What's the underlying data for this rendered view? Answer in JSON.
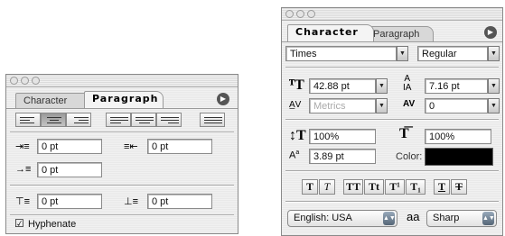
{
  "paragraph_panel": {
    "tabs": [
      {
        "label": "Character"
      },
      {
        "label": "Paragraph"
      }
    ],
    "menu_icon": "flyout-arrow-icon",
    "align_buttons": [
      "align-left",
      "align-center",
      "align-right",
      "justify-left",
      "justify-center",
      "justify-right",
      "justify-all"
    ],
    "left_indent": {
      "icon": "left-indent-icon",
      "value": "0 pt"
    },
    "right_indent": {
      "icon": "right-indent-icon",
      "value": "0 pt"
    },
    "first_line_indent": {
      "icon": "first-line-indent-icon",
      "value": "0 pt"
    },
    "space_before": {
      "icon": "space-before-icon",
      "value": "0 pt"
    },
    "space_after": {
      "icon": "space-after-icon",
      "value": "0 pt"
    },
    "hyphenate": {
      "label": "Hyphenate",
      "checked": true
    }
  },
  "character_panel": {
    "tabs": [
      {
        "label": "Character"
      },
      {
        "label": "Paragraph"
      }
    ],
    "font_family": "Times",
    "font_style": "Regular",
    "font_size": "42.88 pt",
    "leading": "7.16 pt",
    "kerning": "Metrics",
    "tracking": "0",
    "vertical_scale": "100%",
    "horizontal_scale": "100%",
    "baseline_shift": "3.89 pt",
    "color_label": "Color:",
    "color_value": "#000000",
    "style_buttons": [
      {
        "glyph": "T"
      },
      {
        "glyph": "T"
      },
      {
        "glyph": "TT"
      },
      {
        "glyph": "Tt"
      },
      {
        "glyph": "T¹"
      },
      {
        "glyph": "T₁"
      },
      {
        "glyph": "T"
      },
      {
        "glyph": "T"
      }
    ],
    "language": "English: USA",
    "antialias_icon_text": "aa",
    "antialias": "Sharp"
  }
}
